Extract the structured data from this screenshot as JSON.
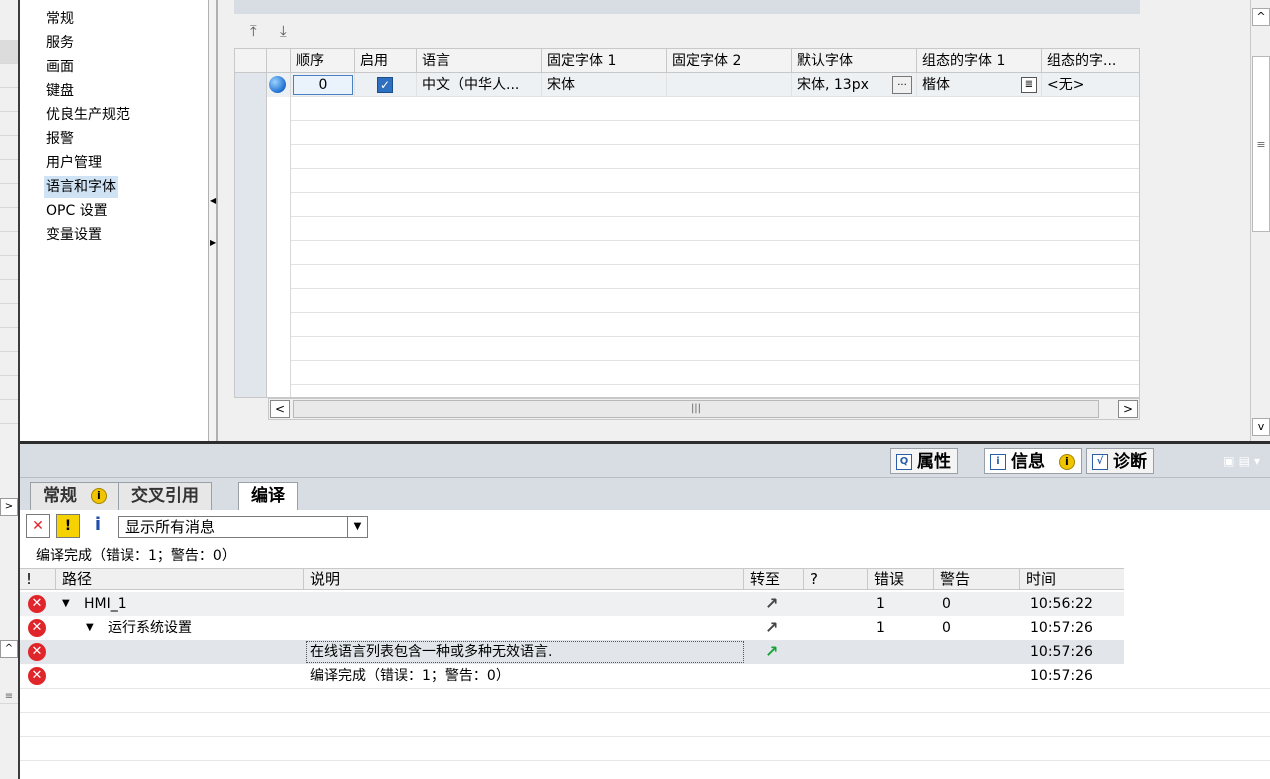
{
  "nav": {
    "items": [
      "常规",
      "服务",
      "画面",
      "键盘",
      "优良生产规范",
      "报警",
      "用户管理",
      "语言和字体",
      "OPC 设置",
      "变量设置"
    ],
    "selected_index": 7
  },
  "grid": {
    "columns": [
      "顺序",
      "启用",
      "语言",
      "固定字体 1",
      "固定字体 2",
      "默认字体",
      "组态的字体 1",
      "组态的字..."
    ],
    "row": {
      "order": "0",
      "enabled": true,
      "language": "中文（中华人...",
      "fixed_font_1": "宋体",
      "fixed_font_2": "",
      "default_font": "宋体, 13px",
      "configured_font_1": "楷体",
      "configured_font_2": "<无>"
    },
    "browse_label": "..."
  },
  "scroll": {
    "left": "<",
    "right": ">",
    "thumb": "|||"
  },
  "inspector": {
    "tabs": [
      "属性",
      "信息",
      "诊断"
    ],
    "active_tab": "信息"
  },
  "subtabs": [
    "常规",
    "交叉引用",
    "编译"
  ],
  "filter": {
    "selected": "显示所有消息"
  },
  "compile_status": "编译完成（错误：1；警告：0）",
  "messages": {
    "columns": [
      "!",
      "路径",
      "说明",
      "转至",
      "?",
      "错误",
      "警告",
      "时间"
    ],
    "rows": [
      {
        "path": "HMI_1",
        "desc": "",
        "errors": "1",
        "warnings": "0",
        "time": "10:56:22"
      },
      {
        "path": "运行系统设置",
        "desc": "",
        "errors": "1",
        "warnings": "0",
        "time": "10:57:26"
      },
      {
        "path": "",
        "desc": "在线语言列表包含一种或多种无效语言.",
        "errors": "",
        "warnings": "",
        "time": "10:57:26"
      },
      {
        "path": "",
        "desc": "编译完成（错误：1；警告：0）",
        "errors": "",
        "warnings": "",
        "time": "10:57:26"
      }
    ]
  }
}
